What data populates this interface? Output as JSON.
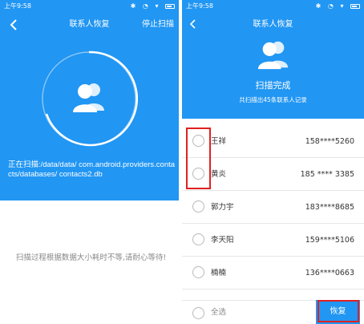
{
  "left": {
    "status_time": "上午9:58",
    "title": "联系人恢复",
    "stop_label": "停止扫描",
    "scan_path": "正在扫描:/data/data/ com.android.providers.contacts/databases/ contacts2.db",
    "hint": "扫描过程根据数据大小耗时不等,请耐心等待!",
    "icons": {
      "back": "back-chevron-icon",
      "avatar": "contacts-avatar-icon"
    },
    "colors": {
      "primary": "#2196f3",
      "hint": "#888888"
    }
  },
  "right": {
    "status_time": "上午9:58",
    "title": "联系人恢复",
    "done_label": "扫描完成",
    "count_label": "共扫描出45条联系人记录",
    "contacts": [
      {
        "name": "王祥",
        "phone": "158****5260"
      },
      {
        "name": "黄炎",
        "phone": "185 **** 3385"
      },
      {
        "name": "郭力宇",
        "phone": "183****8685"
      },
      {
        "name": "李天阳",
        "phone": "159****5106"
      },
      {
        "name": "楠楠",
        "phone": "136****0663"
      }
    ],
    "select_all_label": "全选",
    "restore_label": "恢复",
    "colors": {
      "primary": "#2196f3",
      "highlight": "#e02020"
    }
  }
}
